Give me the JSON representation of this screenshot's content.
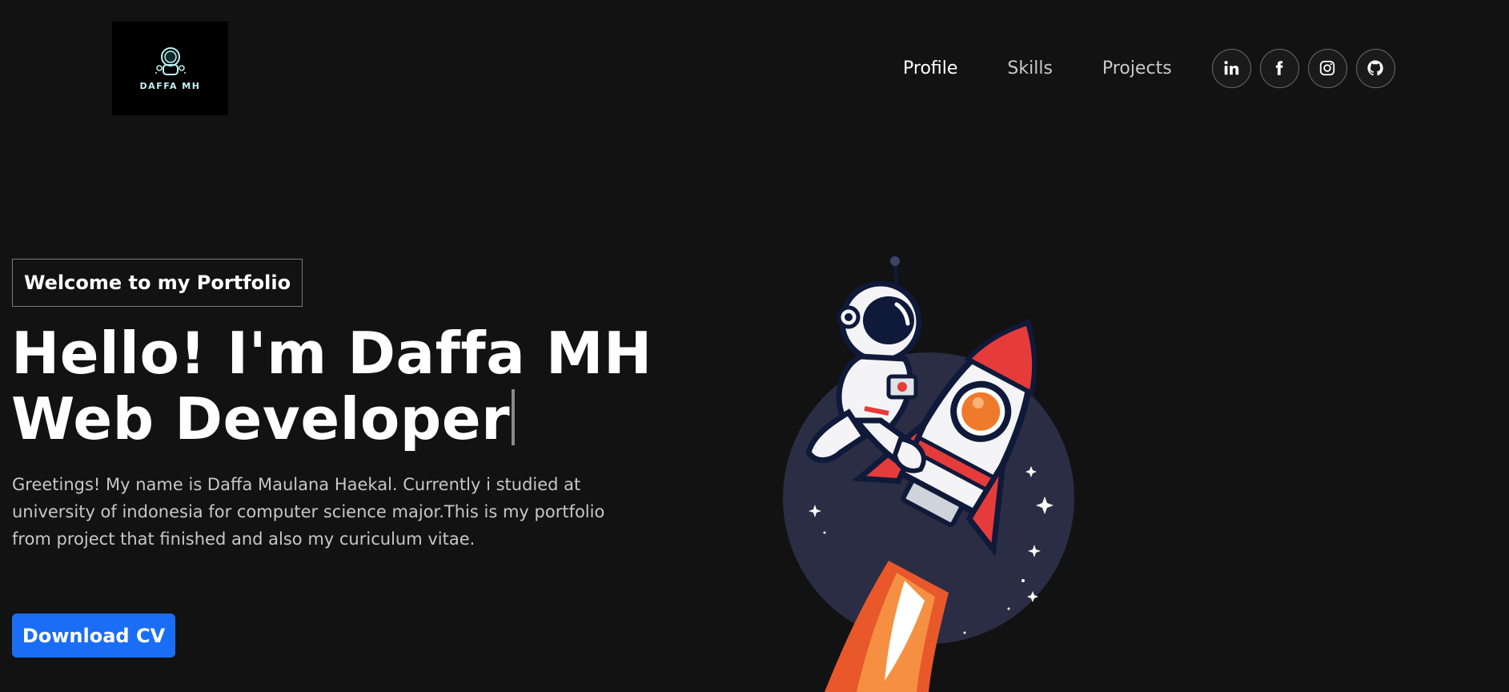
{
  "brand": {
    "logo_text": "DAFFA MH",
    "accent": "#bff3f5"
  },
  "nav": {
    "items": [
      {
        "label": "Profile"
      },
      {
        "label": "Skills"
      },
      {
        "label": "Projects"
      }
    ],
    "socials": [
      "linkedin-icon",
      "facebook-icon",
      "instagram-icon",
      "github-icon"
    ]
  },
  "hero": {
    "tagline": "Welcome to my Portfolio",
    "headline_line1": "Hello! I'm Daffa MH",
    "headline_line2": "Web Developer",
    "intro": "Greetings! My name is Daffa Maulana Haekal. Currently i studied at university of indonesia for computer science major.This is my portfolio from project that finished and also my curiculum vitae.",
    "cta_label": "Download CV",
    "cta_color": "#1a6ef5",
    "illustration": "astronaut-riding-rocket"
  }
}
